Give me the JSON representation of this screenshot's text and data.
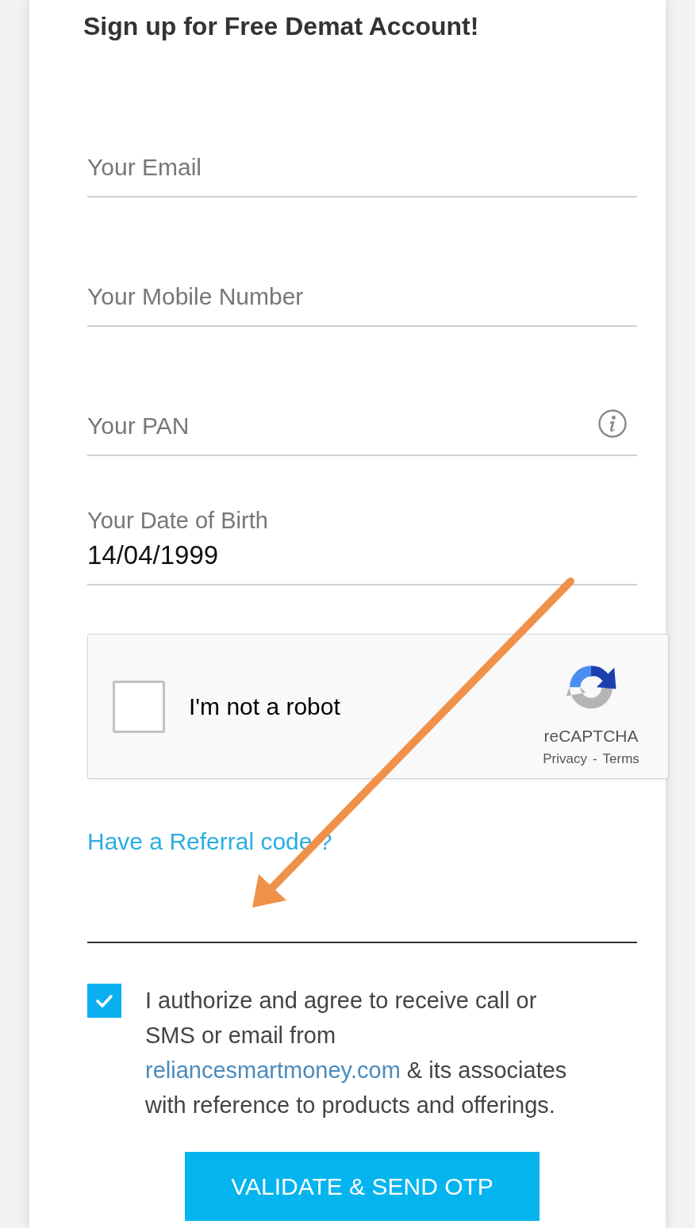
{
  "heading": "Sign up for Free Demat Account!",
  "fields": [
    {
      "kind": "placeholder",
      "placeholder": "Your Email",
      "info": false
    },
    {
      "kind": "placeholder",
      "placeholder": "Your Mobile Number",
      "info": false
    },
    {
      "kind": "placeholder",
      "placeholder": "Your PAN",
      "info": true
    },
    {
      "kind": "filled",
      "label": "Your Date of Birth",
      "value": "14/04/1999",
      "info": false
    }
  ],
  "captcha": {
    "checked": false,
    "label": "I'm not a robot",
    "brand": "reCAPTCHA",
    "privacy": "Privacy",
    "separator": "-",
    "terms": "Terms"
  },
  "referral": {
    "link": "Have a Referral code ?",
    "focused": true
  },
  "consent": {
    "checked": true,
    "before": "I authorize and agree to receive call or SMS or email from",
    "link": "reliancesmartmoney.com",
    "after": "& its associates with reference to products and offerings."
  },
  "submit": {
    "label": "VALIDATE & SEND OTP"
  }
}
